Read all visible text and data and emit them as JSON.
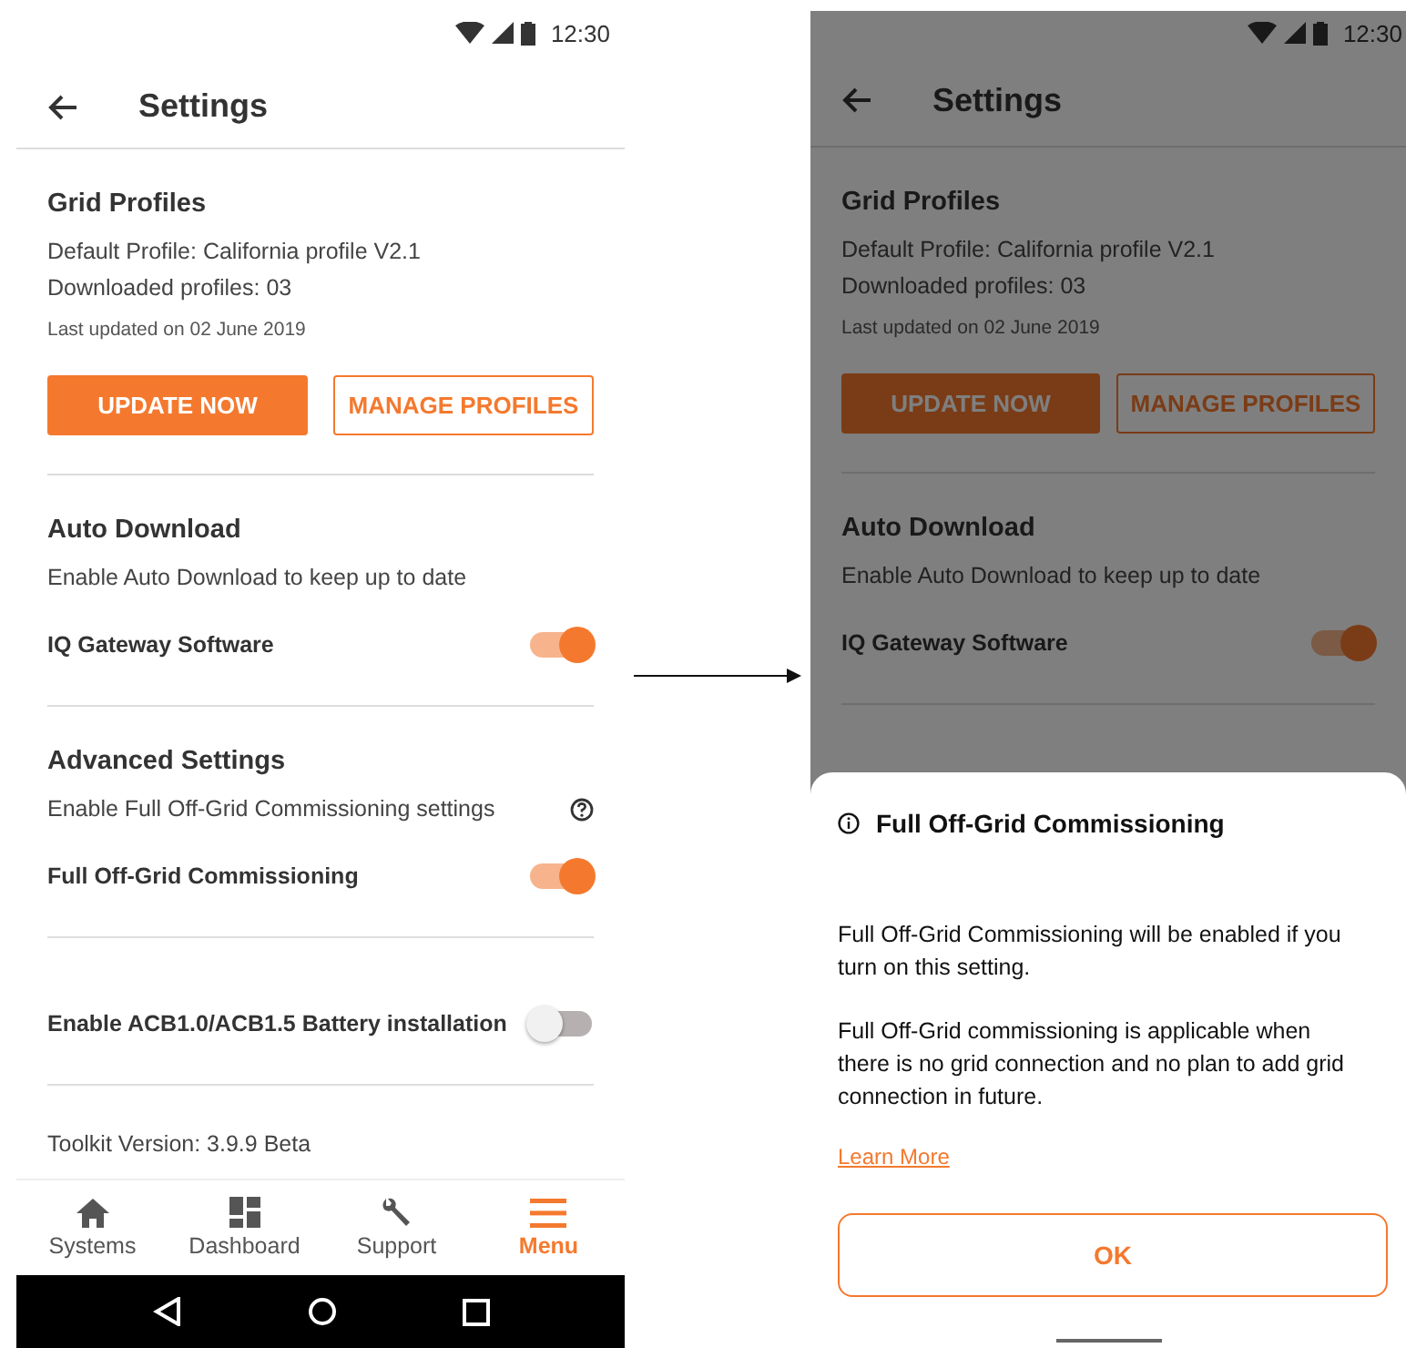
{
  "screens": [
    {
      "dimmed": false,
      "status_bar": {
        "time": "12:30"
      },
      "app_bar": {
        "title": "Settings"
      },
      "sections": [
        {
          "items": [
            {
              "kind": "heading",
              "text": "Grid Profiles"
            },
            {
              "kind": "text",
              "text": "Default Profile: California profile V2.1"
            },
            {
              "kind": "text",
              "text": "Downloaded profiles: 03"
            },
            {
              "kind": "caption",
              "text": "Last updated on 02 June 2019"
            },
            {
              "kind": "buttons",
              "buttons": [
                {
                  "label": "UPDATE NOW",
                  "kind": "filled"
                },
                {
                  "label": "MANAGE PROFILES",
                  "kind": "outlined"
                }
              ]
            }
          ]
        },
        {
          "items": [
            {
              "kind": "heading",
              "text": "Auto Download"
            },
            {
              "kind": "text",
              "text": "Enable Auto Download to keep up to date"
            },
            {
              "kind": "toggle",
              "text": "IQ Gateway Software",
              "on": true
            }
          ]
        },
        {
          "items": [
            {
              "kind": "heading",
              "text": "Advanced Settings"
            },
            {
              "kind": "help",
              "text": "Enable Full Off-Grid Commissioning settings"
            },
            {
              "kind": "toggle",
              "text": "Full Off-Grid Commissioning",
              "on": true
            }
          ]
        },
        {
          "items": [
            {
              "kind": "toggle",
              "text": "Enable ACB1.0/ACB1.5 Battery installation",
              "on": false
            }
          ]
        }
      ],
      "version": "Toolkit Version: 3.9.9 Beta",
      "bottom_nav": [
        {
          "label": "Systems",
          "selected": false
        },
        {
          "label": "Dashboard",
          "selected": false
        },
        {
          "label": "Support",
          "selected": false
        },
        {
          "label": "Menu",
          "selected": true
        }
      ]
    },
    {
      "dimmed": true,
      "status_bar": {
        "time": "12:30"
      },
      "app_bar": {
        "title": "Settings"
      },
      "sections": [
        {
          "items": [
            {
              "kind": "heading",
              "text": "Grid Profiles"
            },
            {
              "kind": "text",
              "text": "Default Profile: California profile V2.1"
            },
            {
              "kind": "text",
              "text": "Downloaded profiles: 03"
            },
            {
              "kind": "caption",
              "text": "Last updated on 02 June 2019"
            },
            {
              "kind": "buttons",
              "buttons": [
                {
                  "label": "UPDATE NOW",
                  "kind": "filled"
                },
                {
                  "label": "MANAGE PROFILES",
                  "kind": "outlined"
                }
              ]
            }
          ]
        },
        {
          "items": [
            {
              "kind": "heading",
              "text": "Auto Download"
            },
            {
              "kind": "text",
              "text": "Enable Auto Download to keep up to date"
            },
            {
              "kind": "toggle",
              "text": "IQ Gateway Software",
              "on": true
            }
          ]
        }
      ],
      "sheet": {
        "title": "Full Off-Grid Commissioning",
        "paragraphs": [
          "Full Off-Grid Commissioning will be enabled if you turn on this setting.",
          "Full Off-Grid commissioning is applicable when there is no grid connection and no plan to add grid connection in future."
        ],
        "link": "Learn More",
        "button": "OK"
      }
    }
  ]
}
